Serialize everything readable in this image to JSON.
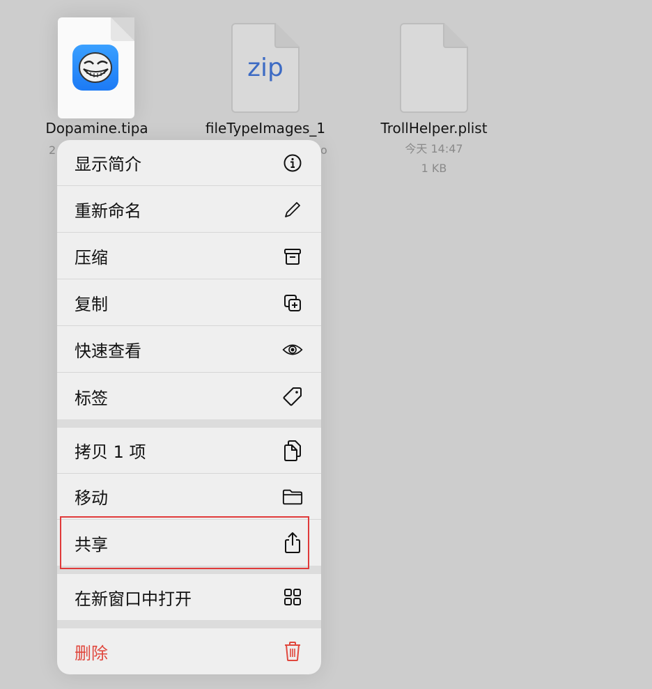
{
  "files": [
    {
      "name": "Dopamine.tipa",
      "meta_partial": "2"
    },
    {
      "name": "fileTypeImages_1",
      "meta_partial": "o",
      "icon_label": "zip"
    },
    {
      "name": "TrollHelper.plist",
      "date": "今天 14:47",
      "size": "1 KB"
    }
  ],
  "menu": {
    "items": [
      {
        "label": "显示简介",
        "icon": "info-icon"
      },
      {
        "label": "重新命名",
        "icon": "pencil-icon"
      },
      {
        "label": "压缩",
        "icon": "archive-box-icon"
      },
      {
        "label": "复制",
        "icon": "duplicate-icon"
      },
      {
        "label": "快速查看",
        "icon": "eye-icon"
      },
      {
        "label": "标签",
        "icon": "tag-icon"
      },
      {
        "label": "拷贝 1 项",
        "icon": "copy-doc-icon"
      },
      {
        "label": "移动",
        "icon": "folder-icon"
      },
      {
        "label": "共享",
        "icon": "share-icon"
      },
      {
        "label": "在新窗口中打开",
        "icon": "grid-icon"
      },
      {
        "label": "删除",
        "icon": "trash-icon"
      }
    ]
  },
  "colors": {
    "danger": "#e0473d",
    "highlight": "#e03a3a",
    "zip": "#3d6bc4"
  }
}
